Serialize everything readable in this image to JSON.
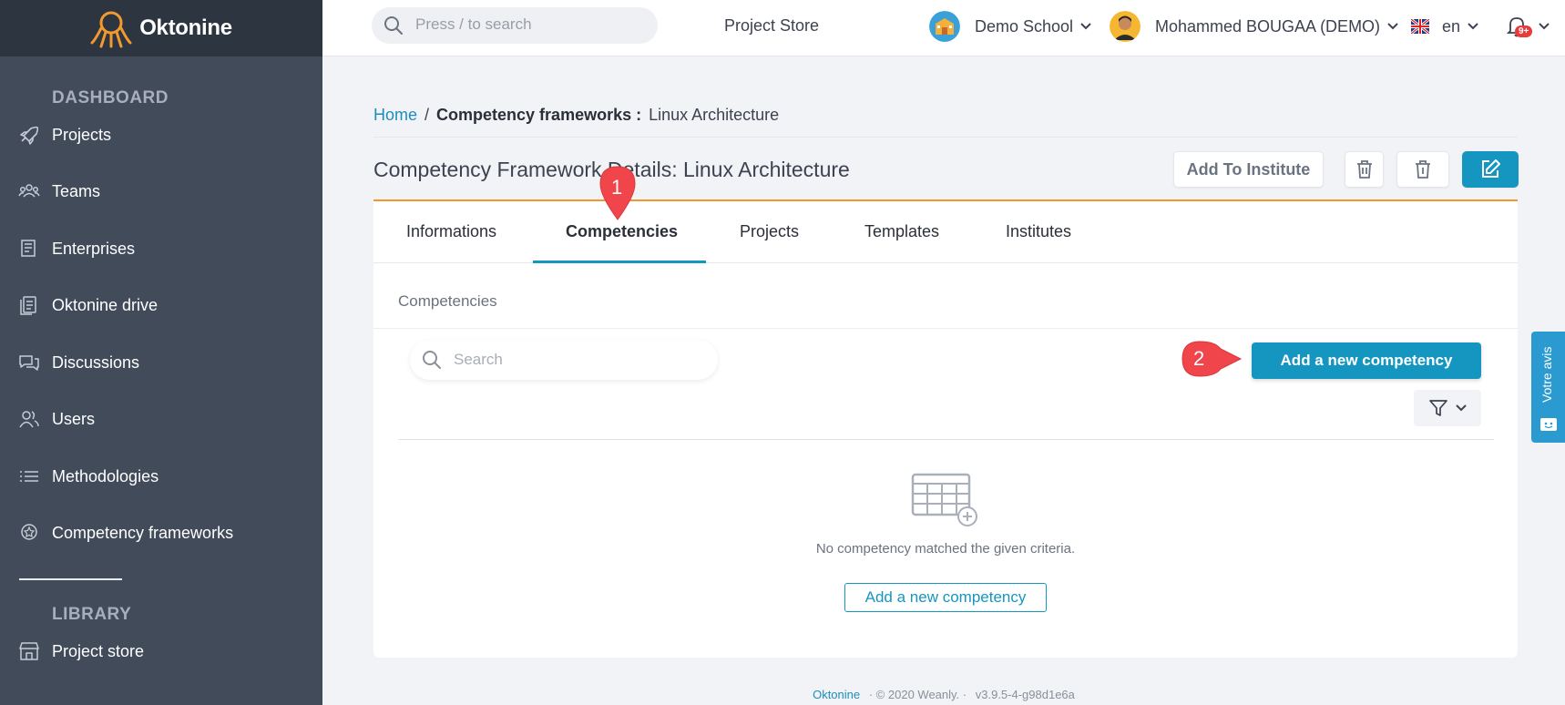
{
  "app": {
    "name": "Oktonine"
  },
  "sidebar": {
    "sections": [
      {
        "title": "DASHBOARD"
      },
      {
        "title": "LIBRARY"
      }
    ],
    "items": [
      {
        "label": "Projects",
        "icon": "rocket-icon"
      },
      {
        "label": "Teams",
        "icon": "team-icon"
      },
      {
        "label": "Enterprises",
        "icon": "building-icon"
      },
      {
        "label": "Oktonine drive",
        "icon": "drive-icon"
      },
      {
        "label": "Discussions",
        "icon": "chat-icon"
      },
      {
        "label": "Users",
        "icon": "users-icon"
      },
      {
        "label": "Methodologies",
        "icon": "list-icon"
      },
      {
        "label": "Competency frameworks",
        "icon": "badge-icon"
      },
      {
        "label": "Project store",
        "icon": "store-icon"
      }
    ]
  },
  "topbar": {
    "search_placeholder": "Press / to search",
    "project_store": "Project Store",
    "school": "Demo School",
    "user": "Mohammed BOUGAA (DEMO)",
    "language": "en",
    "notifications_badge": "9+"
  },
  "breadcrumb": {
    "home": "Home",
    "separator": "/",
    "section": "Competency frameworks :",
    "current": "Linux Architecture"
  },
  "page": {
    "title": "Competency Framework Details: Linux Architecture",
    "add_to_institute": "Add To Institute"
  },
  "tabs": [
    {
      "label": "Informations",
      "active": false
    },
    {
      "label": "Competencies",
      "active": true
    },
    {
      "label": "Projects",
      "active": false
    },
    {
      "label": "Templates",
      "active": false
    },
    {
      "label": "Institutes",
      "active": false
    }
  ],
  "competencies": {
    "section_label": "Competencies",
    "search_placeholder": "Search",
    "add_button": "Add a new competency",
    "empty_message": "No competency matched the given criteria.",
    "empty_add_button": "Add a new competency"
  },
  "annotations": [
    {
      "number": "1"
    },
    {
      "number": "2"
    }
  ],
  "feedback": {
    "label": "Votre avis"
  },
  "footer": {
    "brand": "Oktonine",
    "copyright": "· © 2020 Weanly. ·",
    "version": "v3.9.5-4-g98d1e6a"
  },
  "colors": {
    "sidebar": "#414b5a",
    "sidebar_header": "#2d3540",
    "primary": "#1596c0",
    "accent": "#f0982e",
    "annotation": "#f0454a"
  }
}
